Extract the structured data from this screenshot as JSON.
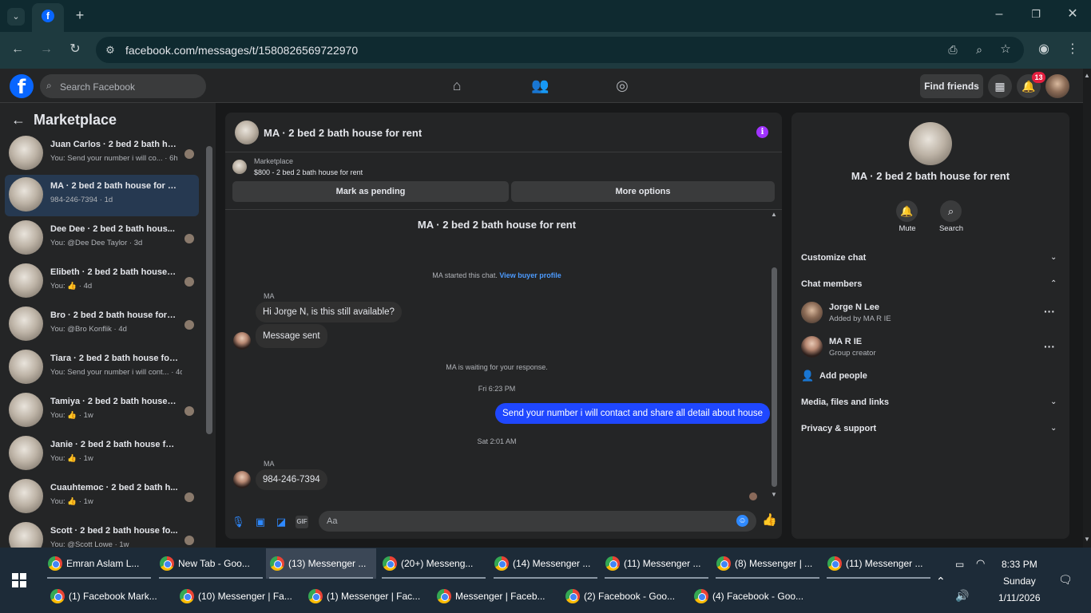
{
  "browser": {
    "url": "facebook.com/messages/t/1580826569722970"
  },
  "header": {
    "search_placeholder": "Search Facebook",
    "find_friends": "Find friends",
    "notif_count": "13"
  },
  "left": {
    "title": "Marketplace",
    "conversations": [
      {
        "name": "Juan Carlos · 2 bed 2 bath ho...",
        "sub": "You: Send your number i will co... · 6h",
        "active": false
      },
      {
        "name": "MA · 2 bed 2 bath house for rent",
        "sub": "984-246-7394 · 1d",
        "active": true
      },
      {
        "name": "Dee Dee · 2 bed 2 bath hous...",
        "sub": "You: @Dee Dee Taylor · 3d",
        "active": false
      },
      {
        "name": "Elibeth · 2 bed 2 bath house f...",
        "sub": "You: 👍 · 4d",
        "active": false
      },
      {
        "name": "Bro · 2 bed 2 bath house for r...",
        "sub": "You: @Bro Konflik · 4d",
        "active": false
      },
      {
        "name": "Tiara · 2 bed 2 bath house for r...",
        "sub": "You: Send your number i will cont... · 4d",
        "active": false
      },
      {
        "name": "Tamiya · 2 bed 2 bath house f...",
        "sub": "You: 👍 · 1w",
        "active": false
      },
      {
        "name": "Janie · 2 bed 2 bath house for r...",
        "sub": "You: 👍 · 1w",
        "active": false
      },
      {
        "name": "Cuauhtemoc · 2 bed 2 bath h...",
        "sub": "You: 👍 · 1w",
        "active": false
      },
      {
        "name": "Scott · 2 bed 2 bath house fo...",
        "sub": "You: @Scott Lowe · 1w",
        "active": false
      }
    ]
  },
  "chat": {
    "title": "MA · 2 bed 2 bath house for rent",
    "listing_label": "Marketplace",
    "listing_price": "$800 - 2 bed 2 bath house for rent",
    "mark_pending": "Mark as pending",
    "more_options": "More options",
    "thread_title": "MA · 2 bed 2 bath house for rent",
    "started_text": "MA started this chat.",
    "view_buyer": "View buyer profile",
    "sender1": "MA",
    "msg1": "Hi Jorge N, is this still available?",
    "msg2": "Message sent",
    "waiting": "MA is waiting for your response.",
    "time1": "Fri 6:23 PM",
    "out1": "Send your number i will contact and share all detail about house",
    "time2": "Sat 2:01 AM",
    "sender2": "MA",
    "msg3": "984-246-7394",
    "composer_placeholder": "Aa"
  },
  "right": {
    "title": "MA · 2 bed 2 bath house for rent",
    "mute": "Mute",
    "search": "Search",
    "customize": "Customize chat",
    "members": "Chat members",
    "member1_name": "Jorge N Lee",
    "member1_sub": "Added by MA R IE",
    "member2_name": "MA R IE",
    "member2_sub": "Group creator",
    "add_people": "Add people",
    "media": "Media, files and links",
    "privacy": "Privacy & support"
  },
  "taskbar": {
    "row1": [
      "Emran Aslam L...",
      "New Tab - Goo...",
      "(13) Messenger ...",
      "(20+) Messeng...",
      "(14) Messenger ...",
      "(11) Messenger ...",
      "(8) Messenger | ...",
      "(11) Messenger ..."
    ],
    "row2": [
      "(1) Facebook Mark...",
      "(10) Messenger | Fa...",
      "(1) Messenger | Fac...",
      "Messenger | Faceb...",
      "(2) Facebook - Goo...",
      "(4) Facebook - Goo..."
    ],
    "time": "8:33 PM",
    "day": "Sunday",
    "date": "1/11/2026"
  }
}
